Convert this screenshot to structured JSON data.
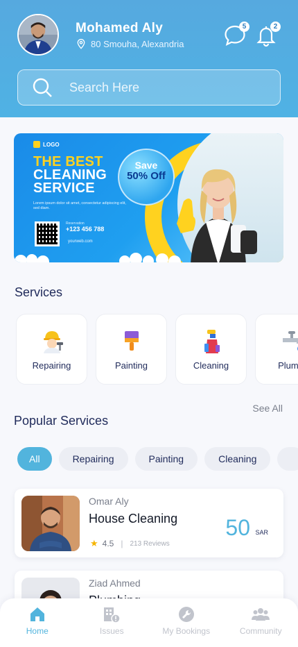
{
  "header": {
    "user_name": "Mohamed Aly",
    "location": "80 Smouha, Alexandria",
    "messages_count": "5",
    "notifications_count": "2",
    "search_placeholder": "Search Here"
  },
  "banner": {
    "logo": "LOGO",
    "title_line1": "THE BEST",
    "title_line2": "CLEANING",
    "title_line3": "SERVICE",
    "lorem": "Lorem ipsum dolor sit amet, consectetur adipiscing elit, sed diam.",
    "save_line1": "Save",
    "save_line2": "50% Off",
    "reservation_label": "Reservation",
    "phone": "+123 456 788",
    "website": "yourweb.com"
  },
  "services": {
    "title": "Services",
    "items": [
      {
        "label": "Repairing",
        "icon": "worker-icon"
      },
      {
        "label": "Painting",
        "icon": "paint-brush-icon"
      },
      {
        "label": "Cleaning",
        "icon": "cleaning-supplies-icon"
      },
      {
        "label": "Plumb",
        "icon": "faucet-icon"
      }
    ]
  },
  "popular": {
    "title": "Popular Services",
    "see_all": "See All",
    "chips": [
      "All",
      "Repairing",
      "Painting",
      "Cleaning"
    ],
    "cards": [
      {
        "provider": "Omar Aly",
        "service": "House Cleaning",
        "rating": "4.5",
        "reviews": "213 Reviews",
        "price": "50",
        "currency": "SAR"
      },
      {
        "provider": "Ziad Ahmed",
        "service": "Plumbing"
      }
    ]
  },
  "nav": {
    "items": [
      {
        "label": "Home",
        "icon": "home-icon"
      },
      {
        "label": "Issues",
        "icon": "building-alert-icon"
      },
      {
        "label": "My Bookings",
        "icon": "wrench-icon"
      },
      {
        "label": "Community",
        "icon": "people-group-icon"
      }
    ]
  },
  "colors": {
    "header": "#56a9df",
    "accent": "#52b4dd",
    "text_dark": "#1f2a5a",
    "star": "#f5b400"
  }
}
